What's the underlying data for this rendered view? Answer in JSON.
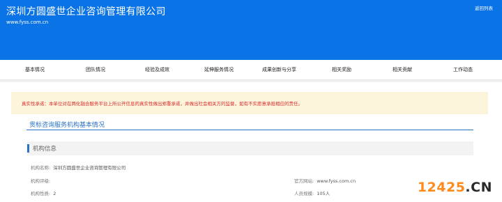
{
  "header": {
    "title": "深圳方圆盛世企业咨询管理有限公司",
    "url": "www.fyss.com.cn",
    "back_label": "返回列表"
  },
  "nav": {
    "items": [
      "基本情况",
      "团队情况",
      "经验及成效",
      "延伸服务情况",
      "成果创新与分享",
      "相关奖励",
      "相关贡献",
      "工作动态"
    ]
  },
  "notice": {
    "text": "真实性承诺：本单位对在两化融合服务平台上所公开信息的真实性做出郑重承诺，并做出社会相关方的监督，如有不实愿意承担相应的责任。"
  },
  "section": {
    "title": "贯标咨询服务机构基本情况",
    "subsection_title": "机构信息"
  },
  "info": {
    "name_label": "机构名称:",
    "name_value": "深圳方圆盛世企业咨询管理有限公司",
    "rating_label": "机构评级:",
    "rating_value": "",
    "website_label": "官方网站:",
    "website_value": "www.fyss.com.cn",
    "nature_label": "机构性质:",
    "nature_value": "2",
    "staff_label": "人员规模:",
    "staff_value": "105人"
  },
  "watermark": {
    "accent": "12425",
    "rest": ".CN",
    "accent_color": "#ff8a1c"
  }
}
